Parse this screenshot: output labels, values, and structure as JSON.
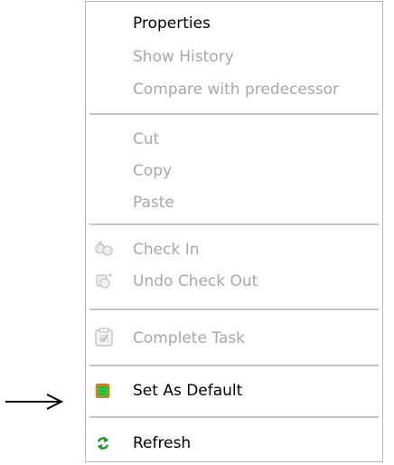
{
  "context_menu": {
    "items": [
      {
        "label": "Properties",
        "enabled": true
      },
      {
        "label": "Show History",
        "enabled": false
      },
      {
        "label": "Compare with predecessor",
        "enabled": false
      },
      {
        "label": "Cut",
        "enabled": false
      },
      {
        "label": "Copy",
        "enabled": false
      },
      {
        "label": "Paste",
        "enabled": false
      },
      {
        "label": "Check In",
        "enabled": false,
        "icon": "check-in-icon"
      },
      {
        "label": "Undo Check Out",
        "enabled": false,
        "icon": "undo-check-out-icon"
      },
      {
        "label": "Complete Task",
        "enabled": false,
        "icon": "complete-task-icon"
      },
      {
        "label": "Set As Default",
        "enabled": true,
        "icon": "set-default-icon"
      },
      {
        "label": "Refresh",
        "enabled": true,
        "icon": "refresh-icon"
      }
    ]
  },
  "colors": {
    "enabled_text": "#000000",
    "disabled_text": "#a7a7a7",
    "separator": "#c4c4c4",
    "set_default_icon_fill": "#3cc83c",
    "set_default_icon_border": "#e8741a",
    "refresh_icon": "#1e9a2c"
  },
  "annotation": {
    "arrow_icon": "arrow-right-icon"
  }
}
